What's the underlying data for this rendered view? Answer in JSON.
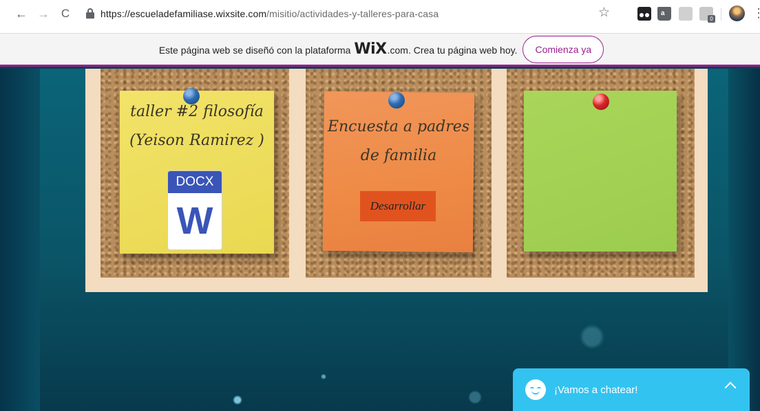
{
  "browser": {
    "url_host": "https://escueladefamiliase.wixsite.com",
    "url_path": "/misitio/actividades-y-talleres-para-casa",
    "back_icon": "←",
    "forward_icon": "→",
    "reload_icon": "C",
    "star_icon": "☆",
    "menu_icon": "⋮",
    "ext_amazon_letter": "a",
    "ext_badge_count": "0"
  },
  "wix_banner": {
    "text_before": "Este página web se diseñó con la plataforma",
    "logo": "WiX",
    "text_after": ".com. Crea tu página web hoy.",
    "button_label": "Comienza ya",
    "accent_color": "#9b1f8d"
  },
  "notes": [
    {
      "color": "#f2e36a",
      "title": "taller #2 filosofía (Yeison Ramirez )",
      "attachment": {
        "band": "DOCX",
        "letter": "W"
      }
    },
    {
      "color": "#ee8a45",
      "title": "Encuesta a padres de familia",
      "button_label": "Desarrollar"
    },
    {
      "color": "#a9d65a",
      "title": ""
    }
  ],
  "chat": {
    "label": "¡Vamos a chatear!",
    "color": "#33c3f0"
  }
}
